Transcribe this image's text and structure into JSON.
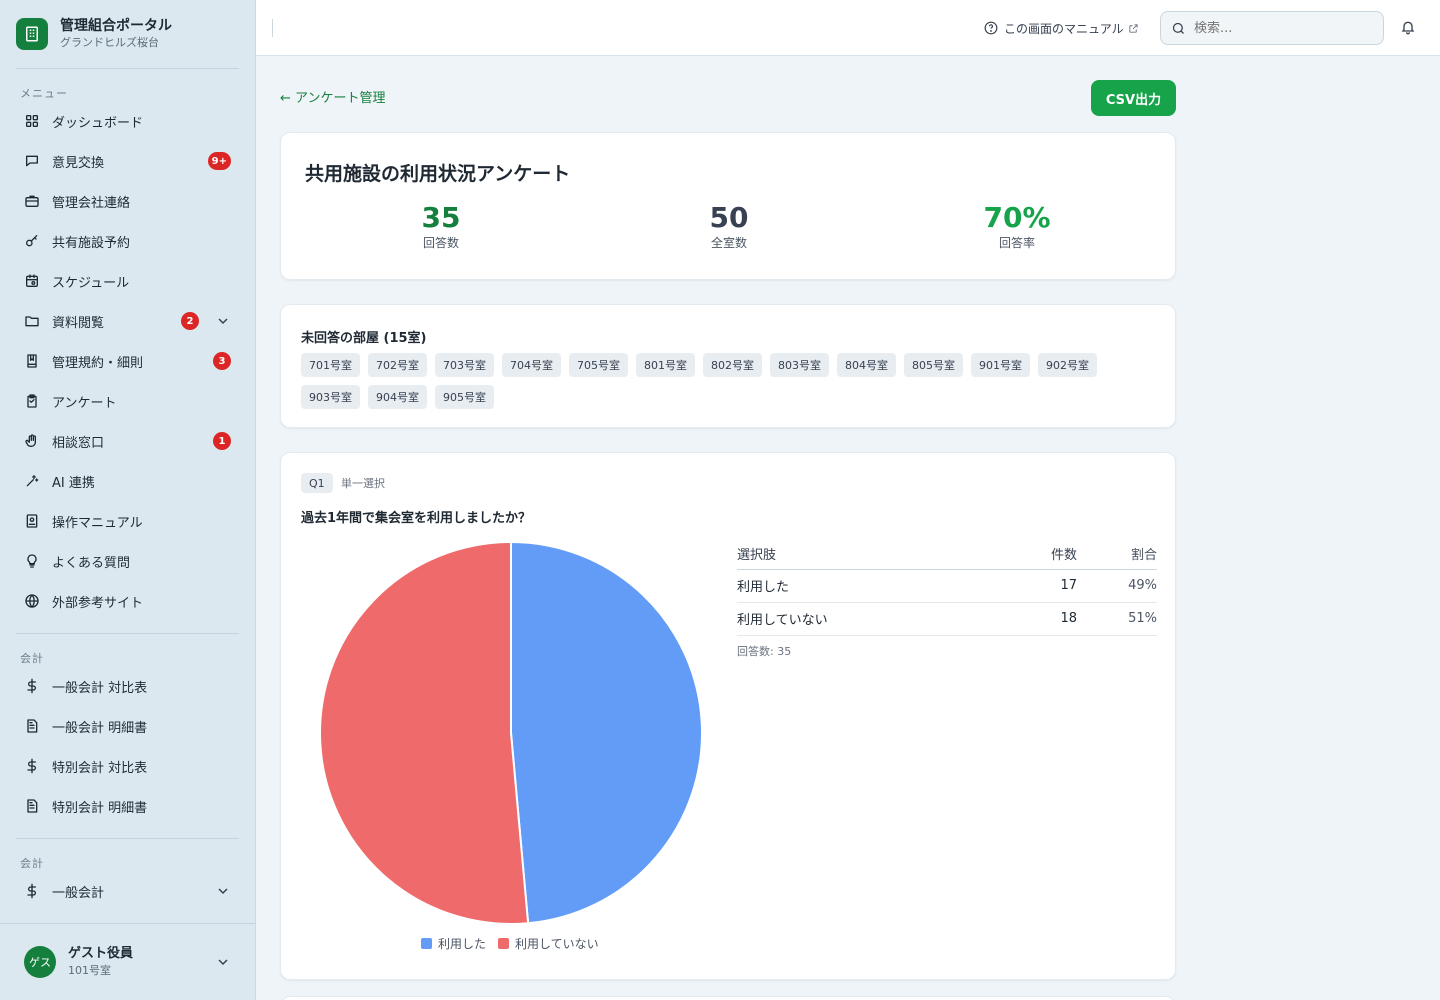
{
  "brand": {
    "title": "管理組合ポータル",
    "subtitle": "グランドヒルズ桜台"
  },
  "sidebar": {
    "menu_label": "メニュー",
    "items": [
      {
        "label": "ダッシュボード",
        "icon": "grid-icon"
      },
      {
        "label": "意見交換",
        "icon": "chat-icon",
        "badge": "9+"
      },
      {
        "label": "管理会社連絡",
        "icon": "briefcase-icon"
      },
      {
        "label": "共有施設予約",
        "icon": "key-icon"
      },
      {
        "label": "スケジュール",
        "icon": "calendar-icon"
      },
      {
        "label": "資料閲覧",
        "icon": "folder-icon",
        "badge": "2",
        "expandable": true
      },
      {
        "label": "管理規約・細則",
        "icon": "book-icon",
        "badge": "3"
      },
      {
        "label": "アンケート",
        "icon": "clipboard-icon"
      },
      {
        "label": "相談窓口",
        "icon": "hand-icon",
        "badge": "1"
      },
      {
        "label": "AI 連携",
        "icon": "sparkle-icon"
      },
      {
        "label": "操作マニュアル",
        "icon": "manual-icon"
      },
      {
        "label": "よくある質問",
        "icon": "lightbulb-icon"
      },
      {
        "label": "外部参考サイト",
        "icon": "globe-icon"
      }
    ],
    "accounting_label": "会計",
    "accounting_items": [
      {
        "label": "一般会計 対比表",
        "icon": "dollar-icon"
      },
      {
        "label": "一般会計 明細書",
        "icon": "document-icon"
      },
      {
        "label": "特別会計 対比表",
        "icon": "dollar-icon"
      },
      {
        "label": "特別会計 明細書",
        "icon": "document-icon"
      }
    ],
    "accounting2_label": "会計",
    "accounting2_items": [
      {
        "label": "一般会計",
        "icon": "dollar-icon",
        "expandable": true
      }
    ]
  },
  "user": {
    "avatar": "ゲス",
    "name": "ゲスト役員",
    "room": "101号室"
  },
  "topbar": {
    "manual_label": "この画面のマニュアル",
    "search_placeholder": "検索..."
  },
  "page": {
    "back_label": "← アンケート管理",
    "csv_label": "CSV出力"
  },
  "survey": {
    "title": "共用施設の利用状況アンケート",
    "stats": [
      {
        "value": "35",
        "label": "回答数",
        "color": "#15803d"
      },
      {
        "value": "50",
        "label": "全室数",
        "color": "#374151"
      },
      {
        "value": "70%",
        "label": "回答率",
        "color": "#16a34a"
      }
    ]
  },
  "unanswered": {
    "title": "未回答の部屋 (15室)",
    "rooms": [
      "701号室",
      "702号室",
      "703号室",
      "704号室",
      "705号室",
      "801号室",
      "802号室",
      "803号室",
      "804号室",
      "805号室",
      "901号室",
      "902号室",
      "903号室",
      "904号室",
      "905号室"
    ]
  },
  "question": {
    "tag": "Q1",
    "type": "単一選択",
    "text": "過去1年間で集会室を利用しましたか？",
    "table_headers": {
      "option": "選択肢",
      "count": "件数",
      "ratio": "割合"
    },
    "rows": [
      {
        "option": "利用した",
        "count": "17",
        "ratio": "49%"
      },
      {
        "option": "利用していない",
        "count": "18",
        "ratio": "51%"
      }
    ],
    "answers_note": "回答数: 35"
  },
  "chart_data": {
    "type": "pie",
    "categories": [
      "利用した",
      "利用していない"
    ],
    "values": [
      17,
      18
    ],
    "colors": [
      "#629cf7",
      "#ef6b6b"
    ],
    "legend": "bottom"
  }
}
